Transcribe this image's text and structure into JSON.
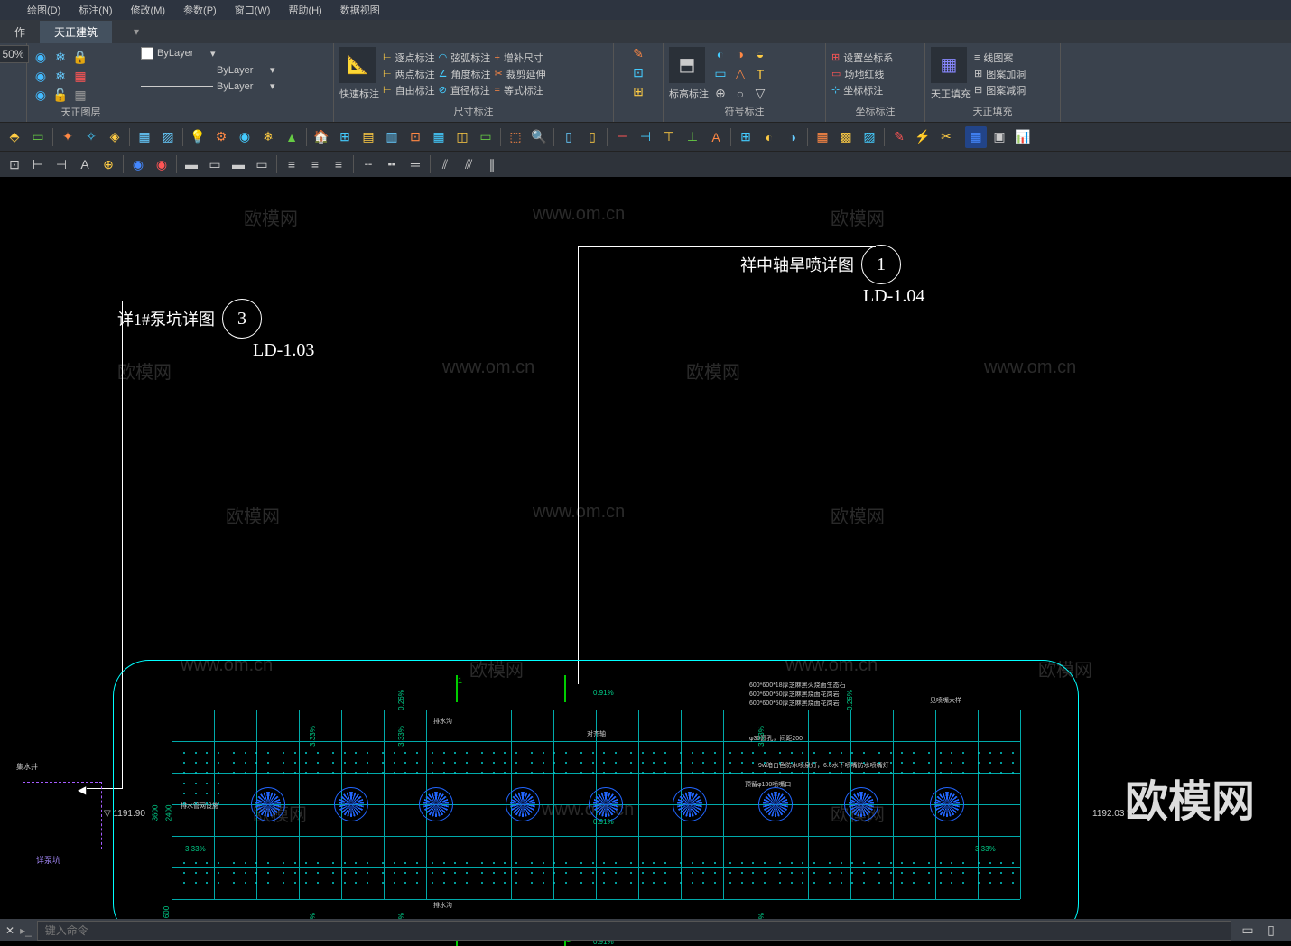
{
  "menubar": {
    "items": [
      "绘图(D)",
      "标注(N)",
      "修改(M)",
      "参数(P)",
      "窗口(W)",
      "帮助(H)",
      "数据视图"
    ]
  },
  "tabbar": {
    "tab1": "作",
    "tab2": "天正建筑"
  },
  "ribbon": {
    "pct": "50%",
    "layer_text": "ByLayer",
    "group_labels": {
      "layers": "天正图层",
      "dim": "尺寸标注",
      "symbol": "符号标注",
      "coord": "坐标标注",
      "fill": "天正填充"
    },
    "quick_dim": "快速标注",
    "elev_dim": "标高标注",
    "tzfill": "天正填充",
    "dim_items": {
      "r1c1": "逐点标注",
      "r1c2": "弦弧标注",
      "r1c3": "增补尺寸",
      "r2c1": "两点标注",
      "r2c2": "角度标注",
      "r2c3": "裁剪延伸",
      "r3c1": "自由标注",
      "r3c2": "直径标注",
      "r3c3": "等式标注"
    },
    "coord_items": {
      "r1": "设置坐标系",
      "r2": "场地红线",
      "r3": "坐标标注"
    },
    "fill_items": {
      "r1": "线图案",
      "r2": "图案加洞",
      "r3": "图案减洞"
    }
  },
  "canvas": {
    "callout1_label": "详1#泵坑详图",
    "callout1_num": "3",
    "callout1_ref": "LD-1.03",
    "callout2_label": "祥中轴旱喷详图",
    "callout2_num": "1",
    "callout2_ref": "LD-1.04",
    "elev_left": "1191.90",
    "elev_right": "1192.03",
    "pump_label": "详泵坑",
    "pump_label2": "集水井",
    "annotations": {
      "a1": "600*600*18厚芝麻黑火烧面生态石",
      "a2": "600*600*50厚芝麻黑烧面花岗岩",
      "a3": "600*600*50厚芝麻黑烧面花岗岩",
      "a4": "600*600*18厚芝麻黑火烧面生态石",
      "a5": "φ30圆孔，间距200",
      "a6": "9w暗白色防水喷泉灯，6.6水下喷嘴防水喷嘴灯",
      "a7": "预留φ130喷嘴口",
      "a8": "见喷嘴大样",
      "a9": "对齐轴",
      "a10": "排水沟",
      "a11": "排水沟",
      "a12": "排水管网设施"
    },
    "dims": {
      "d1": "0.91%",
      "d2": "0.26%",
      "d3": "3.33%",
      "d4": "0.91%",
      "d5": "0.26%",
      "d6": "3.33%",
      "d7": "3.33%",
      "d8": "600",
      "d9": "2400",
      "d10": "3600"
    },
    "watermarks": {
      "wm_brand": "欧模网",
      "wm_url": "www.om.cn"
    }
  },
  "cmdbar": {
    "prompt": "键入命令"
  }
}
